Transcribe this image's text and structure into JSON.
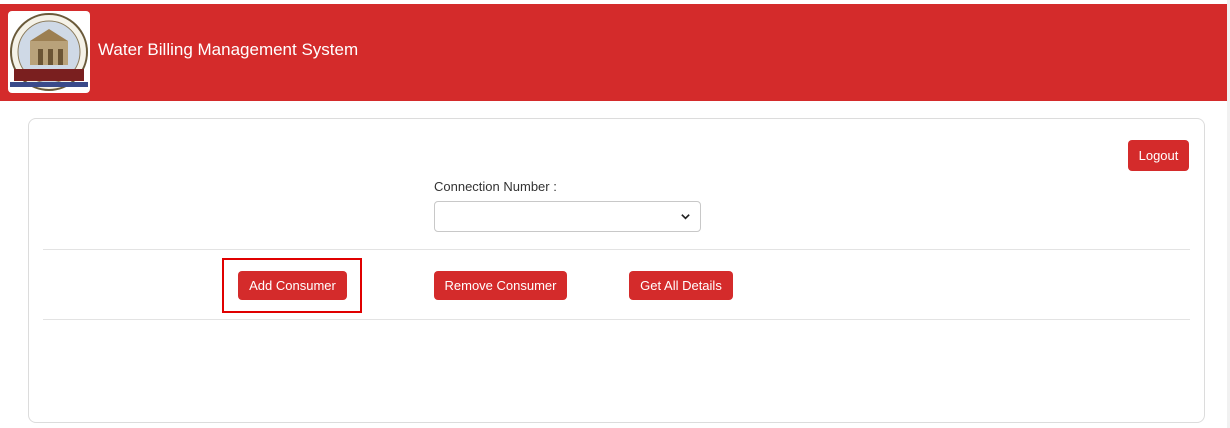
{
  "header": {
    "title": "Water Billing Management System",
    "logo_icon": "municipal-corporation-logo"
  },
  "toolbar": {
    "logout_label": "Logout"
  },
  "form": {
    "connection_label": "Connection Number :",
    "connection_value": ""
  },
  "actions": {
    "add_label": "Add Consumer",
    "remove_label": "Remove Consumer",
    "details_label": "Get All Details"
  },
  "colors": {
    "brand": "#d42b2b",
    "highlight": "#e00000"
  }
}
